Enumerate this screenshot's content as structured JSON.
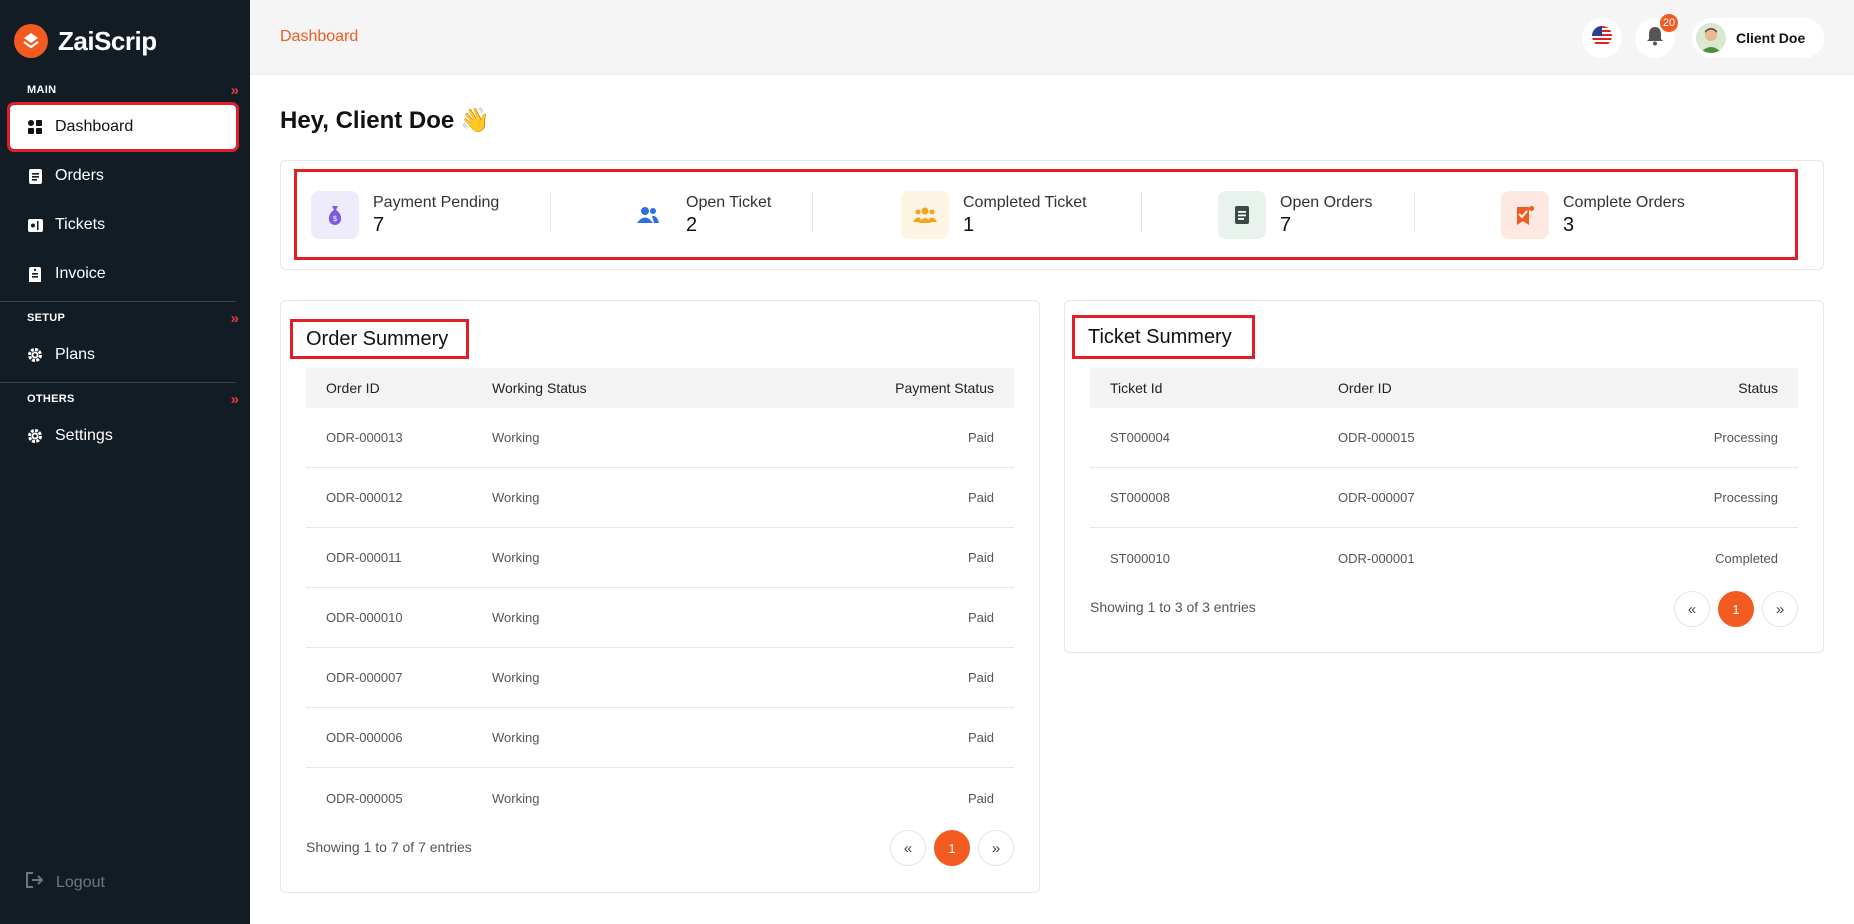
{
  "brand": {
    "name": "ZaiScrip"
  },
  "sidebar": {
    "sections": [
      {
        "title": "MAIN",
        "items": [
          {
            "label": "Dashboard",
            "icon": "grid-icon"
          },
          {
            "label": "Orders",
            "icon": "document-icon"
          },
          {
            "label": "Tickets",
            "icon": "ticket-icon"
          },
          {
            "label": "Invoice",
            "icon": "invoice-icon"
          }
        ]
      },
      {
        "title": "SETUP",
        "items": [
          {
            "label": "Plans",
            "icon": "gear-icon"
          }
        ]
      },
      {
        "title": "OTHERS",
        "items": [
          {
            "label": "Settings",
            "icon": "gear-icon"
          }
        ]
      }
    ],
    "logout": "Logout"
  },
  "header": {
    "breadcrumb": "Dashboard",
    "notification_count": "20",
    "user_name": "Client Doe"
  },
  "greeting": "Hey, Client Doe",
  "greeting_emoji": "👋",
  "stats": [
    {
      "label": "Payment Pending",
      "value": "7",
      "icon": "money-bag-icon",
      "color": "#7b5ce0"
    },
    {
      "label": "Open Ticket",
      "value": "2",
      "icon": "users-icon",
      "color": "#2f6fe0"
    },
    {
      "label": "Completed Ticket",
      "value": "1",
      "icon": "group-icon",
      "color": "#f2a41f"
    },
    {
      "label": "Open Orders",
      "value": "7",
      "icon": "file-icon",
      "color": "#3a5a4a"
    },
    {
      "label": "Complete Orders",
      "value": "3",
      "icon": "check-order-icon",
      "color": "#f25a20"
    }
  ],
  "order_summary": {
    "title": "Order Summery",
    "columns": [
      "Order ID",
      "Working Status",
      "Payment Status"
    ],
    "rows": [
      [
        "ODR-000013",
        "Working",
        "Paid"
      ],
      [
        "ODR-000012",
        "Working",
        "Paid"
      ],
      [
        "ODR-000011",
        "Working",
        "Paid"
      ],
      [
        "ODR-000010",
        "Working",
        "Paid"
      ],
      [
        "ODR-000007",
        "Working",
        "Paid"
      ],
      [
        "ODR-000006",
        "Working",
        "Paid"
      ],
      [
        "ODR-000005",
        "Working",
        "Paid"
      ]
    ],
    "showing": "Showing 1 to 7 of 7 entries",
    "pagination": {
      "prev": "«",
      "page": "1",
      "next": "»"
    }
  },
  "ticket_summary": {
    "title": "Ticket Summery",
    "columns": [
      "Ticket Id",
      "Order ID",
      "Status"
    ],
    "rows": [
      [
        "ST000004",
        "ODR-000015",
        "Processing"
      ],
      [
        "ST000008",
        "ODR-000007",
        "Processing"
      ],
      [
        "ST000010",
        "ODR-000001",
        "Completed"
      ]
    ],
    "showing": "Showing 1 to 3 of 3 entries",
    "pagination": {
      "prev": "«",
      "page": "1",
      "next": "»"
    }
  },
  "colors": {
    "accent": "#f25a20",
    "sidebar_bg": "#121c25",
    "highlight": "#e21f26"
  }
}
